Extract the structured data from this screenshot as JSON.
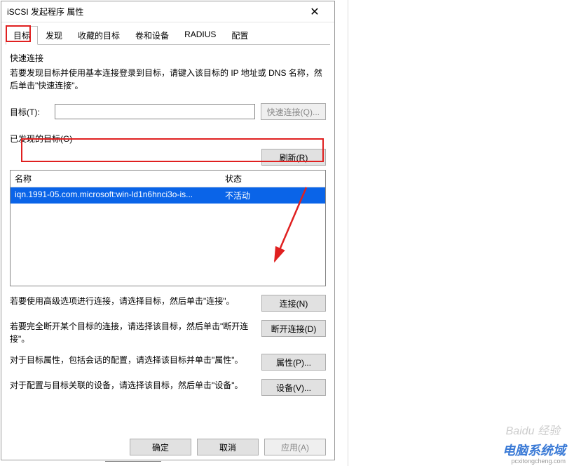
{
  "window": {
    "title": "iSCSI 发起程序 属性",
    "close_glyph": "✕"
  },
  "tabs": [
    {
      "label": "目标",
      "active": true
    },
    {
      "label": "发现",
      "active": false
    },
    {
      "label": "收藏的目标",
      "active": false
    },
    {
      "label": "卷和设备",
      "active": false
    },
    {
      "label": "RADIUS",
      "active": false
    },
    {
      "label": "配置",
      "active": false
    }
  ],
  "quick": {
    "title": "快速连接",
    "desc": "若要发现目标并使用基本连接登录到目标，请键入该目标的 IP 地址或 DNS 名称，然后单击\"快速连接\"。",
    "label": "目标(T):",
    "value": "",
    "button": "快速连接(Q)..."
  },
  "discovered": {
    "title": "已发现的目标(G)",
    "refresh": "刷新(R)",
    "col_name": "名称",
    "col_status": "状态",
    "rows": [
      {
        "name": "iqn.1991-05.com.microsoft:win-ld1n6hnci3o-is...",
        "status": "不活动"
      }
    ]
  },
  "actions": [
    {
      "text": "若要使用高级选项进行连接，请选择目标，然后单击\"连接\"。",
      "button": "连接(N)"
    },
    {
      "text": "若要完全断开某个目标的连接，请选择该目标，然后单击\"断开连接\"。",
      "button": "断开连接(D)"
    },
    {
      "text": "对于目标属性，包括会话的配置，请选择该目标并单击\"属性\"。",
      "button": "属性(P)..."
    },
    {
      "text": "对于配置与目标关联的设备，请选择该目标，然后单击\"设备\"。",
      "button": "设备(V)..."
    }
  ],
  "footer": {
    "ok": "确定",
    "cancel": "取消",
    "apply": "应用(A)"
  },
  "watermark": {
    "baidu": "Baidu 经验",
    "site_cn": "电脑系统域",
    "site_url": "pcxitongcheng.com"
  }
}
